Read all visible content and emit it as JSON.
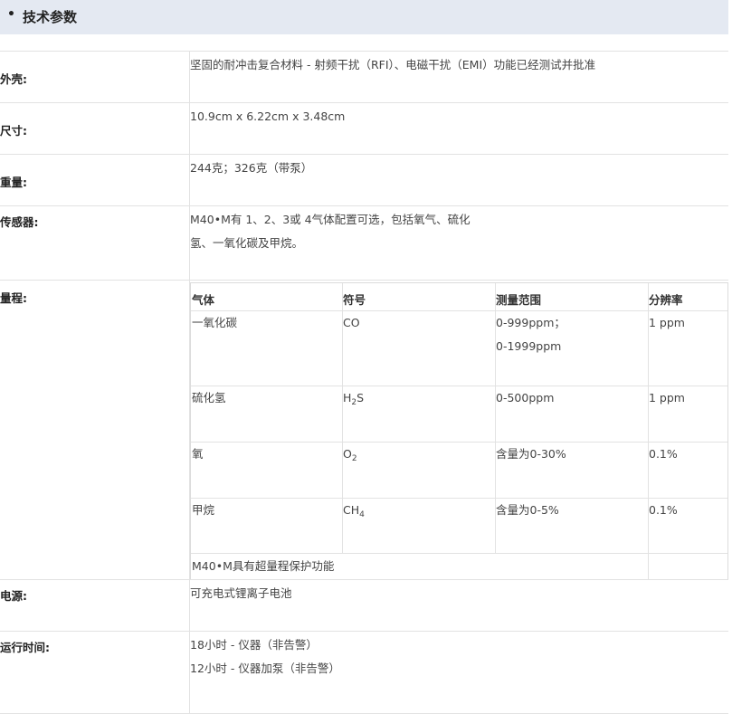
{
  "section": {
    "bullet": "•",
    "title": "技术参数"
  },
  "specs": {
    "housing": {
      "label": "外壳:",
      "value": "坚固的耐冲击复合材料 - 射频干扰（RFI）、电磁干扰（EMI）功能已经测试并批准"
    },
    "size": {
      "label": "尺寸:",
      "value": "10.9cm x 6.22cm x 3.48cm"
    },
    "weight": {
      "label": "重量:",
      "value": "244克；326克（带泵）"
    },
    "sensors": {
      "label": "传感器:",
      "lines": [
        "M40•M有 1、2、3或 4气体配置可选，包括氧气、硫化",
        "氢、一氧化碳及甲烷。"
      ]
    },
    "range": {
      "label": "量程:",
      "headers": [
        "气体",
        "符号",
        "测量范围",
        "分辨率"
      ],
      "rows": [
        {
          "gas": "一氧化碳",
          "symbol_main": "CO",
          "symbol_sub": "",
          "range_lines": [
            "0-999ppm；",
            "0-1999ppm"
          ],
          "resolution": "1 ppm"
        },
        {
          "gas": "硫化氢",
          "symbol_main": "H",
          "symbol_sub": "2",
          "symbol_tail": "S",
          "range_lines": [
            "0-500ppm"
          ],
          "resolution": "1 ppm"
        },
        {
          "gas": "氧",
          "symbol_main": "O",
          "symbol_sub": "2",
          "range_lines": [
            "含量为0-30%"
          ],
          "resolution": "0.1%"
        },
        {
          "gas": "甲烷",
          "symbol_main": "CH",
          "symbol_sub": "4",
          "range_lines": [
            "含量为0-5%"
          ],
          "resolution": "0.1%"
        }
      ],
      "footnote": "M40•M具有超量程保护功能"
    },
    "power": {
      "label": "电源:",
      "value": "可充电式锂离子电池"
    },
    "runtime": {
      "label": "运行时间:",
      "lines": [
        "18小时 - 仪器（非告警）",
        "12小时 - 仪器加泵（非告警）"
      ]
    }
  }
}
